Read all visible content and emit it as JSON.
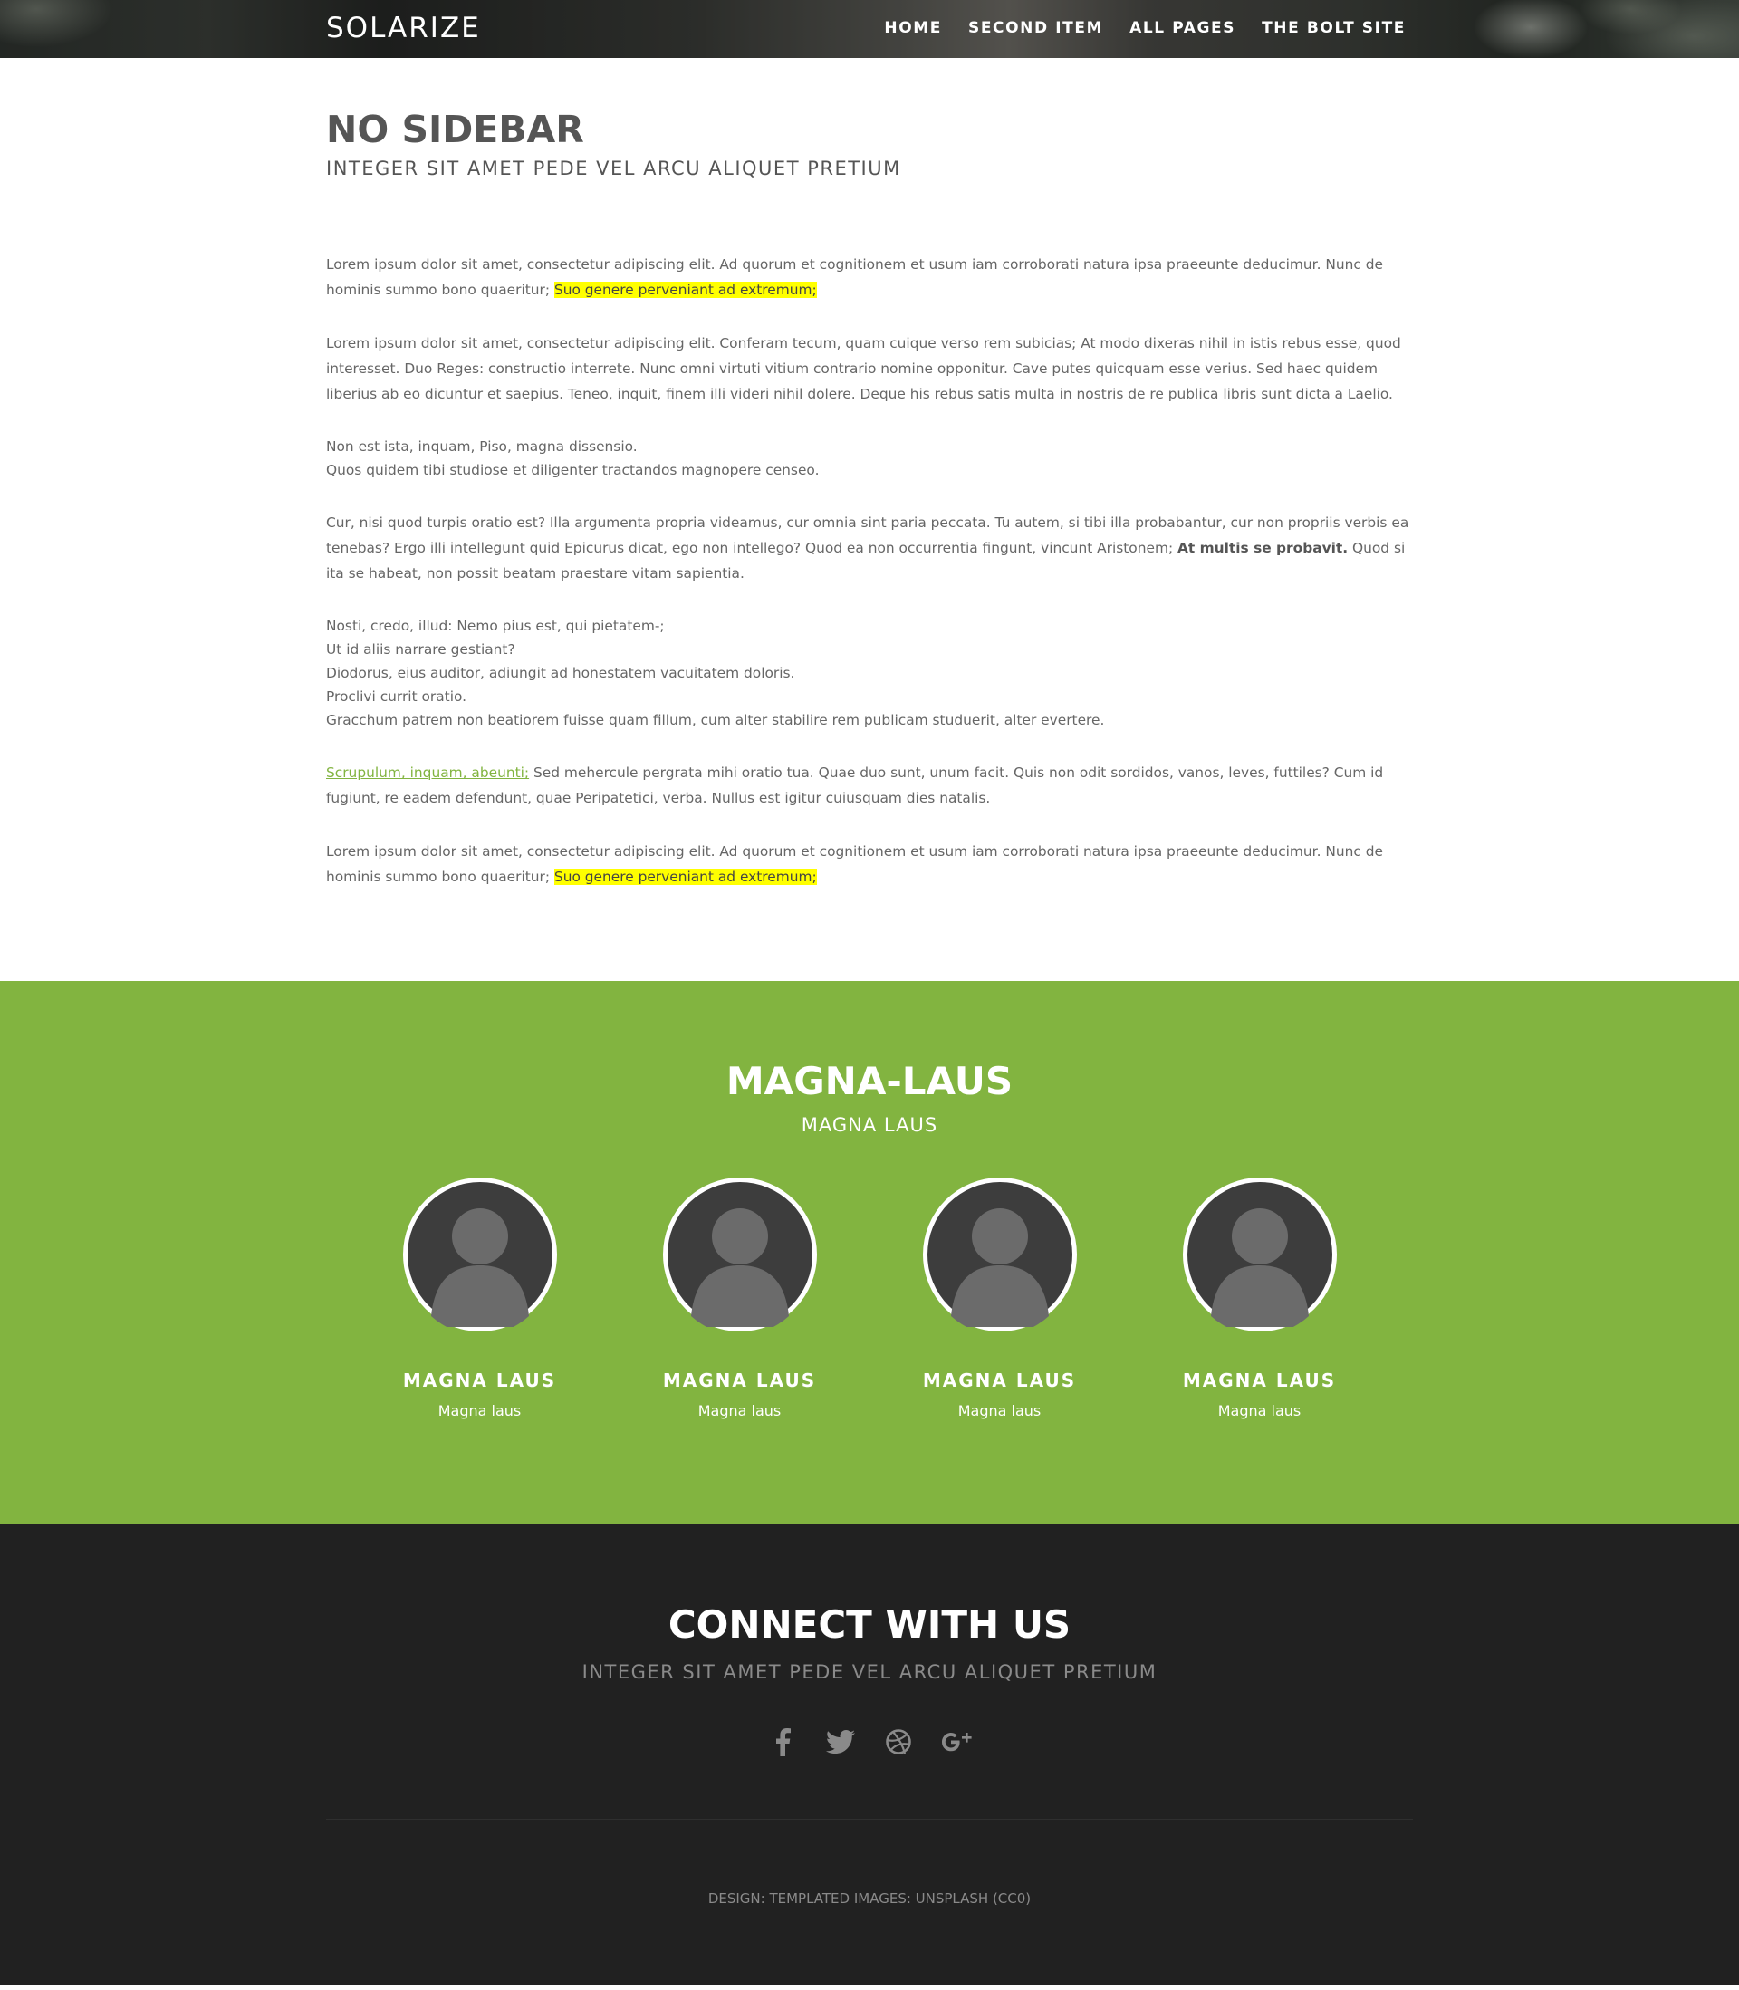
{
  "header": {
    "logo": "SOLARIZE",
    "nav": [
      "HOME",
      "SECOND ITEM",
      "ALL PAGES",
      "THE BOLT SITE"
    ]
  },
  "main": {
    "title": "NO SIDEBAR",
    "subtitle": "INTEGER SIT AMET PEDE VEL ARCU ALIQUET PRETIUM",
    "p1": {
      "text": "Lorem ipsum dolor sit amet, consectetur adipiscing elit. Ad quorum et cognitionem et usum iam corroborati natura ipsa praeeunte deducimur. Nunc de hominis summo bono quaeritur; ",
      "highlight": "Suo genere perveniant ad extremum;"
    },
    "p2": "Lorem ipsum dolor sit amet, consectetur adipiscing elit. Conferam tecum, quam cuique verso rem subicias; At modo dixeras nihil in istis rebus esse, quod interesset. Duo Reges: constructio interrete. Nunc omni virtuti vitium contrario nomine opponitur. Cave putes quicquam esse verius. Sed haec quidem liberius ab eo dicuntur et saepius. Teneo, inquit, finem illi videri nihil dolere. Deque his rebus satis multa in nostris de re publica libris sunt dicta a Laelio.",
    "p3": [
      "Non est ista, inquam, Piso, magna dissensio.",
      "Quos quidem tibi studiose et diligenter tractandos magnopere censeo."
    ],
    "p4": {
      "before": "Cur, nisi quod turpis oratio est? Illa argumenta propria videamus, cur omnia sint paria peccata. Tu autem, si tibi illa probabantur, cur non propriis verbis ea tenebas? Ergo illi intellegunt quid Epicurus dicat, ego non intellego? Quod ea non occurrentia fingunt, vincunt Aristonem; ",
      "bold": "At multis se probavit.",
      "after": " Quod si ita se habeat, non possit beatam praestare vitam sapientia."
    },
    "p5": [
      "Nosti, credo, illud: Nemo pius est, qui pietatem-;",
      "Ut id aliis narrare gestiant?",
      "Diodorus, eius auditor, adiungit ad honestatem vacuitatem doloris.",
      "Proclivi currit oratio.",
      "Gracchum patrem non beatiorem fuisse quam fillum, cum alter stabilire rem publicam studuerit, alter evertere."
    ],
    "p6": {
      "link": "Scrupulum, inquam, abeunti;",
      "text": " Sed mehercule pergrata mihi oratio tua. Quae duo sunt, unum facit. Quis non odit sordidos, vanos, leves, futtiles? Cum id fugiunt, re eadem defendunt, quae Peripatetici, verba. Nullus est igitur cuiusquam dies natalis."
    },
    "p7": {
      "text": "Lorem ipsum dolor sit amet, consectetur adipiscing elit. Ad quorum et cognitionem et usum iam corroborati natura ipsa praeeunte deducimur. Nunc de hominis summo bono quaeritur; ",
      "highlight": "Suo genere perveniant ad extremum;"
    }
  },
  "team": {
    "title": "MAGNA-LAUS",
    "subtitle": "MAGNA LAUS",
    "members": [
      {
        "name": "MAGNA LAUS",
        "role": "Magna laus"
      },
      {
        "name": "MAGNA LAUS",
        "role": "Magna laus"
      },
      {
        "name": "MAGNA LAUS",
        "role": "Magna laus"
      },
      {
        "name": "MAGNA LAUS",
        "role": "Magna laus"
      }
    ]
  },
  "footer": {
    "title": "CONNECT WITH US",
    "subtitle": "INTEGER SIT AMET PEDE VEL ARCU ALIQUET PRETIUM",
    "socials": [
      "facebook-icon",
      "twitter-icon",
      "dribbble-icon",
      "google-plus-icon"
    ],
    "copyright": "DESIGN: TEMPLATED IMAGES: UNSPLASH (CC0)"
  },
  "colors": {
    "accent": "#82b440",
    "highlight": "#ffff00",
    "footer_bg": "#212121",
    "avatar_bg": "#3d3d3d",
    "avatar_figure": "#6b6b6b"
  }
}
